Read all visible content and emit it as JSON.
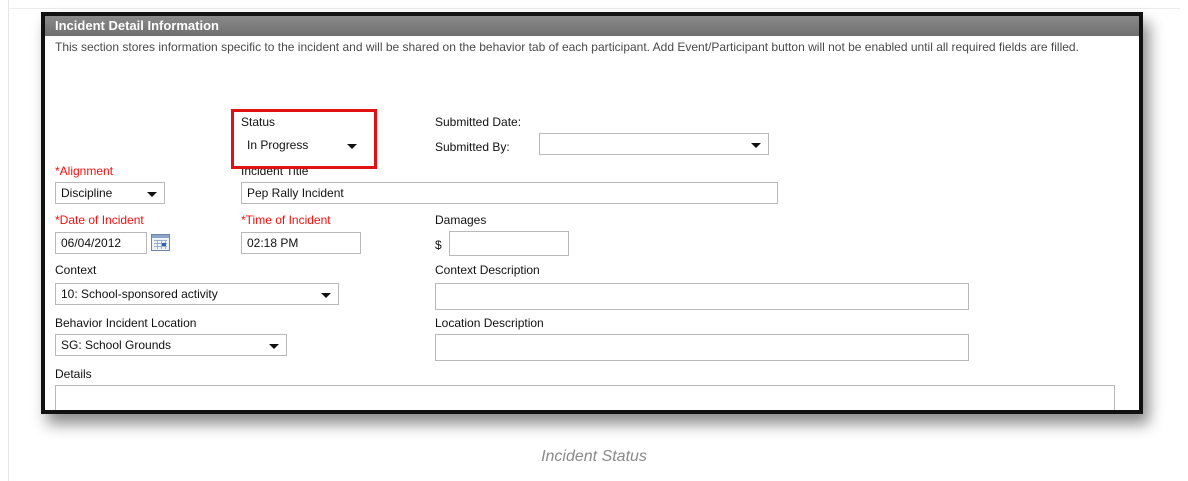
{
  "section": {
    "title": "Incident Detail Information",
    "description": "This section stores information specific to the incident and will be shared on the behavior tab of each participant. Add Event/Participant button will not be enabled until all required fields are filled."
  },
  "fields": {
    "status": {
      "label": "Status",
      "value": "In Progress"
    },
    "submitted_date": {
      "label": "Submitted Date:"
    },
    "submitted_by": {
      "label": "Submitted By:",
      "value": ""
    },
    "alignment": {
      "label": "*Alignment",
      "value": "Discipline"
    },
    "incident_title": {
      "label": "Incident Title",
      "value": "Pep Rally Incident"
    },
    "date_of_incident": {
      "label": "*Date of Incident",
      "value": "06/04/2012"
    },
    "time_of_incident": {
      "label": "*Time of Incident",
      "value": "02:18 PM"
    },
    "damages": {
      "label": "Damages",
      "prefix": "$",
      "value": ""
    },
    "context": {
      "label": "Context",
      "value": "10: School-sponsored activity"
    },
    "context_description": {
      "label": "Context Description",
      "value": ""
    },
    "behavior_location": {
      "label": "Behavior Incident Location",
      "value": "SG: School Grounds"
    },
    "location_description": {
      "label": "Location Description",
      "value": ""
    },
    "details": {
      "label": "Details",
      "value": ""
    }
  },
  "caption": "Incident Status",
  "colors": {
    "required": "#ee1111",
    "highlight": "#e11111",
    "header": "#7a7a7a"
  },
  "icons": {
    "dropdown": "chevron-down-icon",
    "calendar": "calendar-icon"
  }
}
